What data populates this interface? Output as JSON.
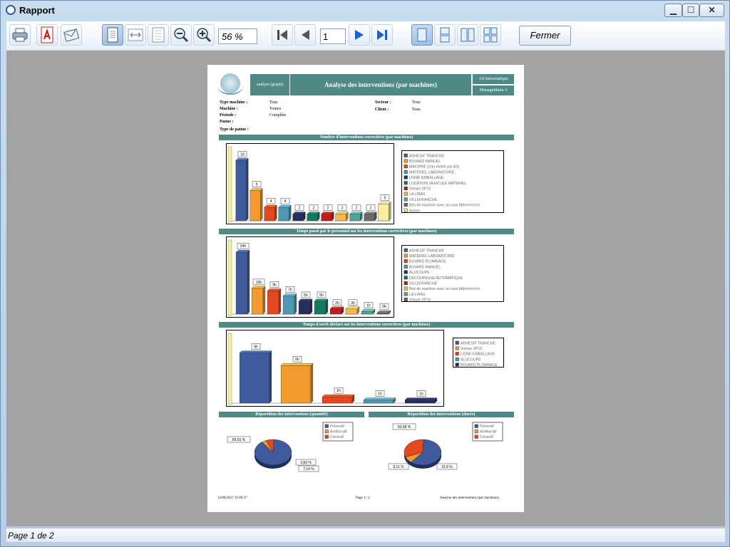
{
  "window": {
    "title": "Rapport",
    "min": "▁",
    "max": "☐",
    "close": "✕"
  },
  "toolbar": {
    "zoom": "56  %",
    "page": "1",
    "close_label": "Fermer",
    "icons": [
      "printer-icon",
      "pdf-icon",
      "email-icon",
      "single-page-icon",
      "page-width-icon",
      "multi-page-icon",
      "zoom-out-icon",
      "zoom-in-icon",
      "first-page-icon",
      "previous-page-icon",
      "next-page-icon",
      "last-page-icon",
      "view-page-icon",
      "view-single-column-icon",
      "view-two-pages-icon",
      "view-grid-icon"
    ]
  },
  "status": "Page 1 de 2",
  "report": {
    "header_small": "analyse (graph)",
    "header_title": "Analyse des interventions (par machines)",
    "header_company": "AS-Informatique",
    "header_product": "ManageMaint 4",
    "filters": {
      "type_machine_label": "Type machine :",
      "type_machine": "Tous",
      "machine_label": "Machine :",
      "machine": "Toutes",
      "periode_label": "Période :",
      "periode": "Complète",
      "panne_label": "Panne :",
      "type_panne_label": "Type de panne :",
      "secteur_label": "Secteur :",
      "secteur": "Tous",
      "client_label": "Client :",
      "client": "Tous"
    },
    "footer_date": "12/06/2017 11:09:37",
    "footer_page": "Page 1 / 2",
    "footer_title": "Analyse des interventions (par machines)"
  },
  "colors": {
    "teal": "#4f8a86",
    "c1": "#3f5b9c",
    "c2": "#f29a2e",
    "c3": "#e5481e",
    "c4": "#4f97b5",
    "c5": "#223060",
    "c6": "#137a60",
    "c7": "#c11b1b",
    "c8": "#f6b84a",
    "c9": "#4fa59a",
    "c10": "#6b6b6b",
    "c11": "#f6ee9c"
  },
  "chart_data": [
    {
      "type": "bar",
      "title": "Nombre d'interventions correctives (par machines)",
      "categories": [
        "ADHESIF TRANCHE",
        "BUVARD MANUEL",
        "MACHINE (non visible par AS)",
        "MATERIEL LABORATOIRE",
        "LIGNE EMBALLAGE",
        "LOCATION VEHICULE MATERIEL",
        "Voiture XP15",
        "LA LIRAS",
        "VILLEFRANCHE",
        "Bris de machine avec un nom tttttrrrrrrrrrrrrr",
        "Autres"
      ],
      "values": [
        18,
        9,
        4,
        4,
        2,
        2,
        2,
        2,
        2,
        2,
        5
      ],
      "labels": [
        "18",
        "9",
        "4",
        "4",
        "2",
        "2",
        "2",
        "2",
        "2",
        "2",
        "5"
      ],
      "legend": [
        "ADHESIF TRANCHE",
        "BUVARD MANUEL",
        "MACHINE (non visible par AS)",
        "MATERIEL LABORATOIRE",
        "LIGNE EMBALLAGE",
        "LOCATION VEHICULE MATERIEL",
        "Voiture XP15",
        "LA LIRAS",
        "VILLEFRANCHE",
        "Bris de machine avec un nom tttttrrrrrrrrrrrrr",
        "Autres"
      ],
      "ylim": [
        0,
        20
      ]
    },
    {
      "type": "bar",
      "title": "Temps passé par le personnel sur les interventions correctives (par machines)",
      "categories": [
        "ADHESIF TRANCHE",
        "MATERIEL LABORATOIRE",
        "BUVARD PLOMBAGE",
        "BUVARD MANUEL",
        "ALUCOUPE",
        "DECOUPEUSE AUTOMATIQUE",
        "VILLEFRANCHE",
        "Bris de machine avec un nom tttttrrrrrrrrrrrrr",
        "LA LIRAS",
        "Voiture XP15"
      ],
      "values": [
        24,
        10,
        9,
        7,
        5,
        5,
        2,
        2,
        1,
        0.5
      ],
      "labels": [
        "24h",
        "10h",
        "9h",
        "7h",
        "5h",
        "5h",
        "2h",
        "2h",
        "1h",
        "0h"
      ],
      "legend": [
        "ADHESIF TRANCHE",
        "MATERIEL LABORATOIRE",
        "BUVARD PLOMBAGE",
        "BUVARD MANUEL",
        "ALUCOUPE",
        "DECOUPEUSE AUTOMATIQUE",
        "VILLEFRANCHE",
        "Bris de machine avec un nom tttttrrrrrrrrrrrrr",
        "LA LIRAS",
        "Voiture XP15"
      ],
      "ylim": [
        0,
        26
      ]
    },
    {
      "type": "bar",
      "title": "Temps d'arrêt déclaré sur les interventions correctives (par machines)",
      "categories": [
        "ADHESIF TRANCHE",
        "Voiture XP15",
        "LIGNE EMBALLAGE",
        "ALUCOUPE",
        "BUVARD PLOMBAGE"
      ],
      "values": [
        8,
        6,
        1,
        0.5,
        0.5
      ],
      "labels": [
        "8h",
        "6h",
        "1h",
        "1h",
        "1h"
      ],
      "legend": [
        "ADHESIF TRANCHE",
        "Voiture XP15",
        "LIGNE EMBALLAGE",
        "ALUCOUPE",
        "BUVARD PLOMBAGE"
      ],
      "ylim": [
        0,
        10
      ]
    },
    {
      "type": "pie",
      "title": "Répartition des interventions (quantité)",
      "categories": [
        "Préventif",
        "Amélioratif",
        "Correctif"
      ],
      "values": [
        89.03,
        3.83,
        7.14
      ],
      "labels": [
        "89,03 %",
        "3,83 %",
        "7,14 %"
      ]
    },
    {
      "type": "pie",
      "title": "Répartition des interventions (durée)",
      "categories": [
        "Préventif",
        "Amélioratif",
        "Correctif"
      ],
      "values": [
        60.08,
        8.11,
        31.8
      ],
      "labels": [
        "60,08 %",
        "8,11 %",
        "31,8 %"
      ]
    }
  ]
}
